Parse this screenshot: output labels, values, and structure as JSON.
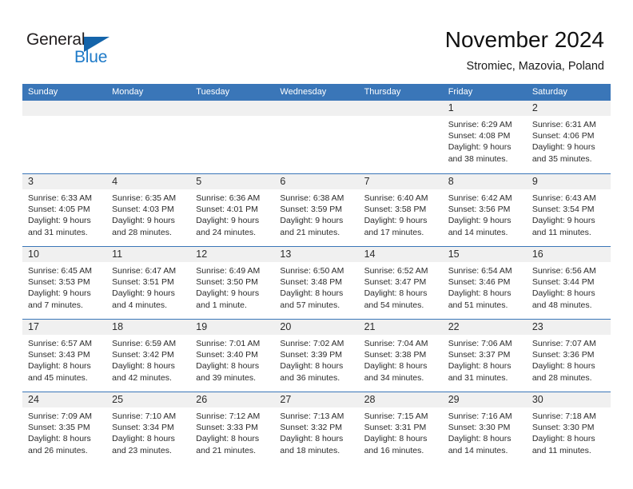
{
  "brand": {
    "name_top": "General",
    "name_bottom": "Blue",
    "triangle_icon": "triangle-icon",
    "color_dark": "#231f20",
    "color_blue": "#1e7ac8"
  },
  "header": {
    "title": "November 2024",
    "subtitle": "Stromiec, Mazovia, Poland"
  },
  "theme": {
    "header_bar_color": "#3a76b8",
    "daynum_band_color": "#f0f0f0",
    "text_color": "#2b2b2b"
  },
  "weekdays": [
    "Sunday",
    "Monday",
    "Tuesday",
    "Wednesday",
    "Thursday",
    "Friday",
    "Saturday"
  ],
  "weeks": [
    [
      {
        "day": "",
        "empty": true
      },
      {
        "day": "",
        "empty": true
      },
      {
        "day": "",
        "empty": true
      },
      {
        "day": "",
        "empty": true
      },
      {
        "day": "",
        "empty": true
      },
      {
        "day": "1",
        "sunrise": "Sunrise: 6:29 AM",
        "sunset": "Sunset: 4:08 PM",
        "daylight1": "Daylight: 9 hours",
        "daylight2": "and 38 minutes."
      },
      {
        "day": "2",
        "sunrise": "Sunrise: 6:31 AM",
        "sunset": "Sunset: 4:06 PM",
        "daylight1": "Daylight: 9 hours",
        "daylight2": "and 35 minutes."
      }
    ],
    [
      {
        "day": "3",
        "sunrise": "Sunrise: 6:33 AM",
        "sunset": "Sunset: 4:05 PM",
        "daylight1": "Daylight: 9 hours",
        "daylight2": "and 31 minutes."
      },
      {
        "day": "4",
        "sunrise": "Sunrise: 6:35 AM",
        "sunset": "Sunset: 4:03 PM",
        "daylight1": "Daylight: 9 hours",
        "daylight2": "and 28 minutes."
      },
      {
        "day": "5",
        "sunrise": "Sunrise: 6:36 AM",
        "sunset": "Sunset: 4:01 PM",
        "daylight1": "Daylight: 9 hours",
        "daylight2": "and 24 minutes."
      },
      {
        "day": "6",
        "sunrise": "Sunrise: 6:38 AM",
        "sunset": "Sunset: 3:59 PM",
        "daylight1": "Daylight: 9 hours",
        "daylight2": "and 21 minutes."
      },
      {
        "day": "7",
        "sunrise": "Sunrise: 6:40 AM",
        "sunset": "Sunset: 3:58 PM",
        "daylight1": "Daylight: 9 hours",
        "daylight2": "and 17 minutes."
      },
      {
        "day": "8",
        "sunrise": "Sunrise: 6:42 AM",
        "sunset": "Sunset: 3:56 PM",
        "daylight1": "Daylight: 9 hours",
        "daylight2": "and 14 minutes."
      },
      {
        "day": "9",
        "sunrise": "Sunrise: 6:43 AM",
        "sunset": "Sunset: 3:54 PM",
        "daylight1": "Daylight: 9 hours",
        "daylight2": "and 11 minutes."
      }
    ],
    [
      {
        "day": "10",
        "sunrise": "Sunrise: 6:45 AM",
        "sunset": "Sunset: 3:53 PM",
        "daylight1": "Daylight: 9 hours",
        "daylight2": "and 7 minutes."
      },
      {
        "day": "11",
        "sunrise": "Sunrise: 6:47 AM",
        "sunset": "Sunset: 3:51 PM",
        "daylight1": "Daylight: 9 hours",
        "daylight2": "and 4 minutes."
      },
      {
        "day": "12",
        "sunrise": "Sunrise: 6:49 AM",
        "sunset": "Sunset: 3:50 PM",
        "daylight1": "Daylight: 9 hours",
        "daylight2": "and 1 minute."
      },
      {
        "day": "13",
        "sunrise": "Sunrise: 6:50 AM",
        "sunset": "Sunset: 3:48 PM",
        "daylight1": "Daylight: 8 hours",
        "daylight2": "and 57 minutes."
      },
      {
        "day": "14",
        "sunrise": "Sunrise: 6:52 AM",
        "sunset": "Sunset: 3:47 PM",
        "daylight1": "Daylight: 8 hours",
        "daylight2": "and 54 minutes."
      },
      {
        "day": "15",
        "sunrise": "Sunrise: 6:54 AM",
        "sunset": "Sunset: 3:46 PM",
        "daylight1": "Daylight: 8 hours",
        "daylight2": "and 51 minutes."
      },
      {
        "day": "16",
        "sunrise": "Sunrise: 6:56 AM",
        "sunset": "Sunset: 3:44 PM",
        "daylight1": "Daylight: 8 hours",
        "daylight2": "and 48 minutes."
      }
    ],
    [
      {
        "day": "17",
        "sunrise": "Sunrise: 6:57 AM",
        "sunset": "Sunset: 3:43 PM",
        "daylight1": "Daylight: 8 hours",
        "daylight2": "and 45 minutes."
      },
      {
        "day": "18",
        "sunrise": "Sunrise: 6:59 AM",
        "sunset": "Sunset: 3:42 PM",
        "daylight1": "Daylight: 8 hours",
        "daylight2": "and 42 minutes."
      },
      {
        "day": "19",
        "sunrise": "Sunrise: 7:01 AM",
        "sunset": "Sunset: 3:40 PM",
        "daylight1": "Daylight: 8 hours",
        "daylight2": "and 39 minutes."
      },
      {
        "day": "20",
        "sunrise": "Sunrise: 7:02 AM",
        "sunset": "Sunset: 3:39 PM",
        "daylight1": "Daylight: 8 hours",
        "daylight2": "and 36 minutes."
      },
      {
        "day": "21",
        "sunrise": "Sunrise: 7:04 AM",
        "sunset": "Sunset: 3:38 PM",
        "daylight1": "Daylight: 8 hours",
        "daylight2": "and 34 minutes."
      },
      {
        "day": "22",
        "sunrise": "Sunrise: 7:06 AM",
        "sunset": "Sunset: 3:37 PM",
        "daylight1": "Daylight: 8 hours",
        "daylight2": "and 31 minutes."
      },
      {
        "day": "23",
        "sunrise": "Sunrise: 7:07 AM",
        "sunset": "Sunset: 3:36 PM",
        "daylight1": "Daylight: 8 hours",
        "daylight2": "and 28 minutes."
      }
    ],
    [
      {
        "day": "24",
        "sunrise": "Sunrise: 7:09 AM",
        "sunset": "Sunset: 3:35 PM",
        "daylight1": "Daylight: 8 hours",
        "daylight2": "and 26 minutes."
      },
      {
        "day": "25",
        "sunrise": "Sunrise: 7:10 AM",
        "sunset": "Sunset: 3:34 PM",
        "daylight1": "Daylight: 8 hours",
        "daylight2": "and 23 minutes."
      },
      {
        "day": "26",
        "sunrise": "Sunrise: 7:12 AM",
        "sunset": "Sunset: 3:33 PM",
        "daylight1": "Daylight: 8 hours",
        "daylight2": "and 21 minutes."
      },
      {
        "day": "27",
        "sunrise": "Sunrise: 7:13 AM",
        "sunset": "Sunset: 3:32 PM",
        "daylight1": "Daylight: 8 hours",
        "daylight2": "and 18 minutes."
      },
      {
        "day": "28",
        "sunrise": "Sunrise: 7:15 AM",
        "sunset": "Sunset: 3:31 PM",
        "daylight1": "Daylight: 8 hours",
        "daylight2": "and 16 minutes."
      },
      {
        "day": "29",
        "sunrise": "Sunrise: 7:16 AM",
        "sunset": "Sunset: 3:30 PM",
        "daylight1": "Daylight: 8 hours",
        "daylight2": "and 14 minutes."
      },
      {
        "day": "30",
        "sunrise": "Sunrise: 7:18 AM",
        "sunset": "Sunset: 3:30 PM",
        "daylight1": "Daylight: 8 hours",
        "daylight2": "and 11 minutes."
      }
    ]
  ]
}
